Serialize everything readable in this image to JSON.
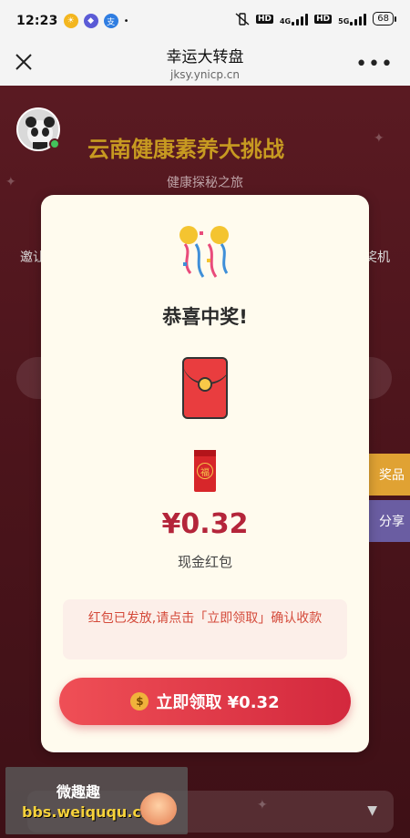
{
  "status_bar": {
    "time": "12:23",
    "network_4g": "4G",
    "network_5g": "5G",
    "hd1": "HD",
    "hd2": "HD",
    "battery": "68"
  },
  "title_bar": {
    "title": "幸运大转盘",
    "url": "jksy.ynicp.cn"
  },
  "background_page": {
    "title": "云南健康素养大挑战",
    "subtitle": "健康探秘之旅",
    "invite_fragment": "邀让",
    "lottery_fragment": "奖机",
    "prize_tab": "奖品",
    "share_tab": "分享"
  },
  "modal": {
    "congrats": "恭喜中奖!",
    "amount": "¥0.32",
    "amount_label": "现金红包",
    "notice": "红包已发放,请点击「立即领取」确认收款",
    "claim_button": "立即领取 ¥0.32",
    "fu_char": "福"
  },
  "watermark": {
    "name": "微趣趣",
    "url": "bbs.weiququ.cn"
  },
  "colors": {
    "accent": "#d3283d",
    "amount": "#b4253a",
    "page_bg": "#4b141b",
    "gold": "#c79a21"
  }
}
